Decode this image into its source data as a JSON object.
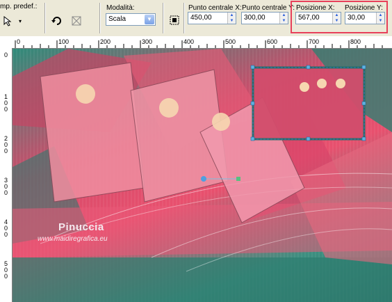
{
  "toolbar": {
    "preset_label": "mp. predef.:",
    "mode_label": "Modalità:",
    "mode_value": "Scala",
    "center_x_label": "Punto centrale X:",
    "center_x_value": "450,00",
    "center_y_label": "Punto centrale Y:",
    "center_y_value": "300,00",
    "pos_x_label": "Posizione X:",
    "pos_x_value": "567,00",
    "pos_y_label": "Posizione Y:",
    "pos_y_value": "30,00"
  },
  "ruler_top": [
    "0",
    "100",
    "200",
    "300",
    "400",
    "500",
    "600",
    "700",
    "800"
  ],
  "ruler_left": [
    "0",
    "100",
    "200",
    "300",
    "400",
    "500"
  ],
  "watermark": {
    "name": "Pinuccia",
    "url": "www.maidiregrafica.eu"
  },
  "colors": {
    "highlight": "#e8405a",
    "teal": "#2f8b7a",
    "pink": "#e8506e"
  }
}
